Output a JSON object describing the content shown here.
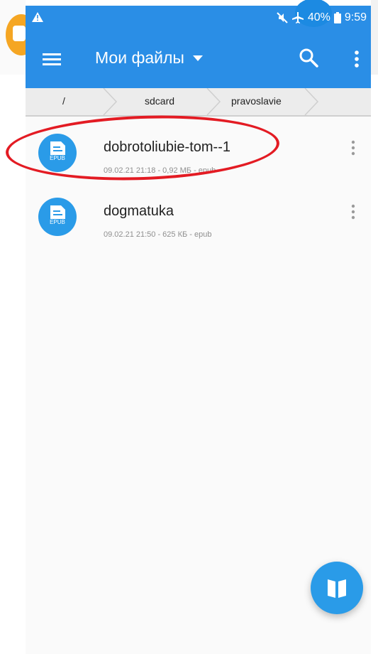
{
  "status_bar": {
    "warning_icon": "warning-triangle-icon",
    "mute_icon": "mute-icon",
    "airplane_icon": "airplane-icon",
    "battery_percent": "40%",
    "battery_icon": "battery-icon",
    "time": "9:59"
  },
  "app_bar": {
    "menu_icon": "hamburger-menu-icon",
    "title": "Мои файлы",
    "dropdown_icon": "dropdown-arrow-icon",
    "search_icon": "search-icon",
    "more_icon": "more-vertical-icon",
    "color": "#2a8ee6"
  },
  "breadcrumb": {
    "items": [
      "/",
      "sdcard",
      "pravoslavie"
    ]
  },
  "files": [
    {
      "name": "dobrotoliubie-tom--1",
      "meta": "09.02.21 21:18 - 0,92 МБ - epub",
      "icon": "epub-file-icon",
      "icon_label": "EPUB"
    },
    {
      "name": "dogmatuka",
      "meta": "09.02.21 21:50 - 625 КБ - epub",
      "icon": "epub-file-icon",
      "icon_label": "EPUB"
    }
  ],
  "fab": {
    "icon": "open-book-icon",
    "color": "#2a9be8"
  },
  "annotation": {
    "color": "#e31b23"
  }
}
